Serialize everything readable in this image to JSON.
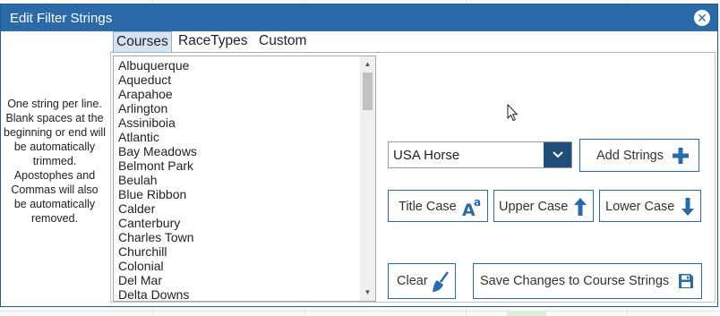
{
  "dialog": {
    "title": "Edit Filter Strings",
    "help_text": "One string per line. Blank spaces at the beginning or end will be automatically trimmed. Apostophes and Commas will also be automatically removed."
  },
  "tabs": [
    {
      "label": "Courses",
      "active": true
    },
    {
      "label": "RaceTypes",
      "active": false
    },
    {
      "label": "Custom",
      "active": false
    }
  ],
  "course_list": [
    "Albuquerque",
    "Aqueduct",
    "Arapahoe",
    "Arlington",
    "Assiniboia",
    "Atlantic",
    "Bay Meadows",
    "Belmont Park",
    "Beulah",
    "Blue Ribbon",
    "Calder",
    "Canterbury",
    "Charles Town",
    "Churchill",
    "Colonial",
    "Del Mar",
    "Delta Downs"
  ],
  "preset_select": {
    "value": "USA Horse"
  },
  "buttons": {
    "add_strings": "Add Strings",
    "title_case": "Title Case",
    "upper_case": "Upper Case",
    "lower_case": "Lower Case",
    "clear": "Clear",
    "save": "Save Changes to Course Strings"
  },
  "colors": {
    "titlebar": "#2a6aa8",
    "button_border": "#2a6aa8",
    "icon_blue": "#2a6aa8",
    "select_button": "#1f4e79"
  },
  "icons": [
    "close-icon",
    "chevron-down-icon",
    "plus-icon",
    "title-case-icon",
    "arrow-up-icon",
    "arrow-down-icon",
    "broom-icon",
    "floppy-disk-icon",
    "mouse-cursor-icon"
  ]
}
